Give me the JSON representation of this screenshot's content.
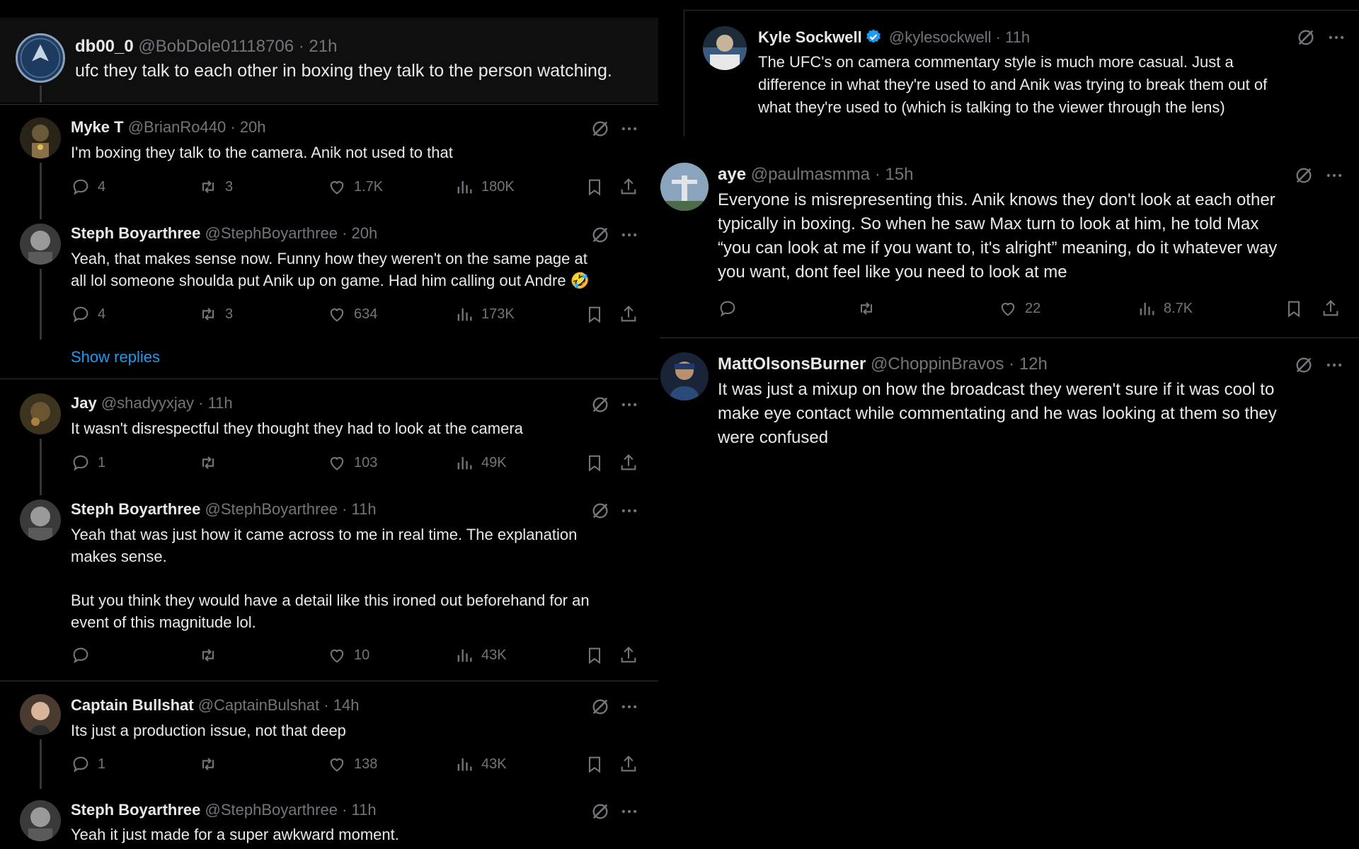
{
  "main_tweet": {
    "name": "db00_0",
    "handle": "@BobDole01118706",
    "time": "· 21h",
    "text": "ufc they talk to each other in boxing they talk to the person watching."
  },
  "left_replies": [
    {
      "name": "Myke T",
      "handle": "@BrianRo440",
      "time": "· 20h",
      "text": "I'm boxing they talk to the camera. Anik not used to that",
      "replies": "4",
      "reposts": "3",
      "likes": "1.7K",
      "views": "180K"
    },
    {
      "name": "Steph Boyarthree",
      "handle": "@StephBoyarthree",
      "time": "· 20h",
      "text": "Yeah, that makes sense now. Funny how they weren't on the same page at\nall lol someone shoulda put Anik up on game. Had him calling out Andre 🤣",
      "replies": "4",
      "reposts": "3",
      "likes": "634",
      "views": "173K"
    },
    {
      "name": "Jay",
      "handle": "@shadyyxjay",
      "time": "· 11h",
      "text": "It wasn't disrespectful they thought they had to look at the camera",
      "replies": "1",
      "reposts": "",
      "likes": "103",
      "views": "49K"
    },
    {
      "name": "Steph Boyarthree",
      "handle": "@StephBoyarthree",
      "time": "· 11h",
      "text": "Yeah that was just how it came across to me in real time. The explanation\nmakes sense.\n\nBut you think they would have a detail like this ironed out beforehand for an\nevent of this magnitude lol.",
      "replies": "",
      "reposts": "",
      "likes": "10",
      "views": "43K"
    },
    {
      "name": "Captain Bullshat",
      "handle": "@CaptainBulshat",
      "time": "· 14h",
      "text": "Its just a production issue, not that deep",
      "replies": "1",
      "reposts": "",
      "likes": "138",
      "views": "43K"
    },
    {
      "name": "Steph Boyarthree",
      "handle": "@StephBoyarthree",
      "time": "· 11h",
      "text": "Yeah it just made for a super awkward moment."
    }
  ],
  "show_replies_label": "Show replies",
  "right_tweets": [
    {
      "name": "Kyle Sockwell",
      "handle": "@kylesockwell",
      "time": "· 11h",
      "verified": true,
      "text": "The UFC's on camera commentary style is much more casual. Just a\ndifference in what they're used to and Anik was trying to break them out of\nwhat they're used to (which is talking to the viewer through the lens)"
    },
    {
      "name": "aye",
      "handle": "@paulmasmma",
      "time": "· 15h",
      "text": "Everyone is misrepresenting this. Anik knows they don't look at each other\ntypically in boxing. So when he saw Max turn to look at him, he told Max\n“you can look at me if you want to, it's alright” meaning, do it whatever way\nyou want, dont feel like you need to look at me",
      "replies": "",
      "reposts": "",
      "likes": "22",
      "views": "8.7K"
    },
    {
      "name": "MattOlsonsBurner",
      "handle": "@ChoppinBravos",
      "time": "· 12h",
      "text": "It was just a mixup on how the broadcast they weren't sure if it was cool to\nmake eye contact while commentating and he was looking at them so they\nwere confused"
    }
  ],
  "colors": {
    "background": "#000000",
    "text": "#e7e9ea",
    "muted": "#71767b",
    "link": "#1d9bf0",
    "verified": "#1d9bf0",
    "divider": "#2f3336"
  }
}
